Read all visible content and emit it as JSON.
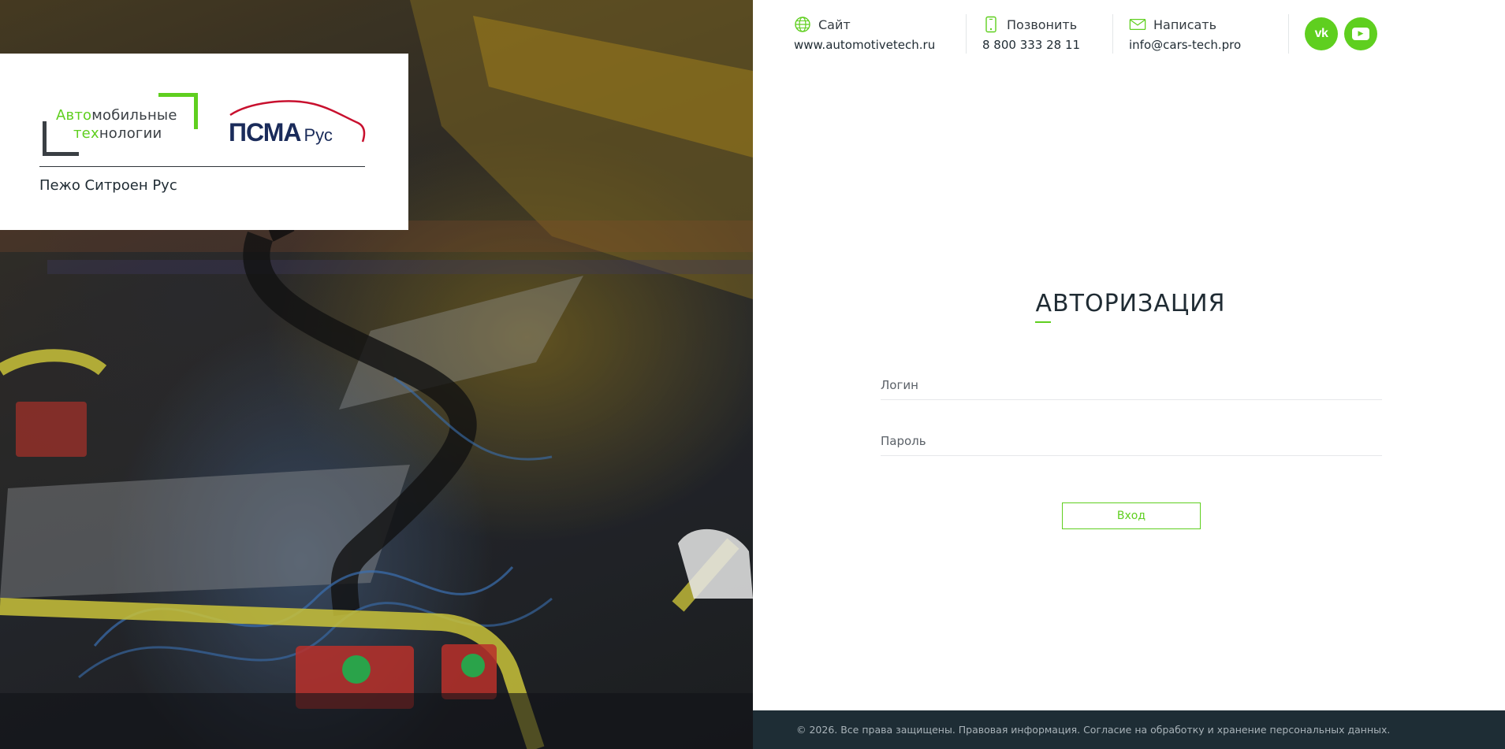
{
  "logo": {
    "at_line1_green": "Авто",
    "at_line1_rest": "мобильные",
    "at_line2_green": "тех",
    "at_line2_rest": "нологии",
    "psma_text": "ПСМА",
    "psma_rus": "Рус",
    "company_name": "Пежо Ситроен Рус"
  },
  "contacts": {
    "site": {
      "label": "Сайт",
      "value": "www.automotivetech.ru",
      "icon": "globe-icon"
    },
    "call": {
      "label": "Позвонить",
      "value": "8 800 333 28 11",
      "icon": "phone-icon"
    },
    "mail": {
      "label": "Написать",
      "value": "info@cars-tech.pro",
      "icon": "envelope-icon"
    }
  },
  "socials": {
    "vk": "vk",
    "youtube": "▶"
  },
  "auth": {
    "title": "АВТОРИЗАЦИЯ",
    "login_placeholder": "Логин",
    "password_placeholder": "Пароль",
    "submit_label": "Вход"
  },
  "footer": {
    "copyright": "© 2026. Все права защищены.",
    "legal": "Правовая информация.",
    "consent": "Согласие на обработку и хранение персональных данных."
  },
  "colors": {
    "accent": "#5fcf1f",
    "dark": "#1e2d35",
    "brand_navy": "#1a2b5a",
    "brand_red": "#c8102e"
  }
}
